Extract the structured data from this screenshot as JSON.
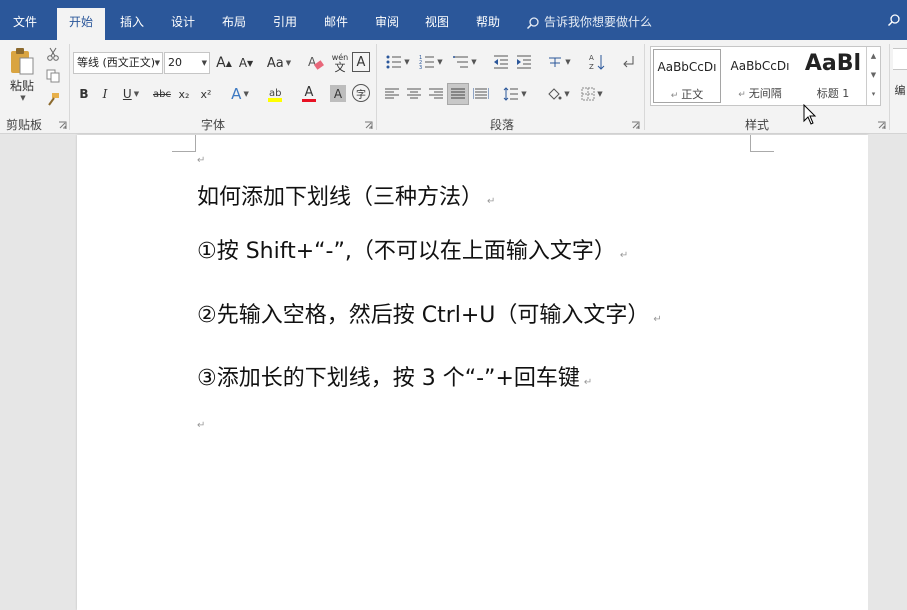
{
  "tabs": {
    "file": "文件",
    "home": "开始",
    "insert": "插入",
    "design": "设计",
    "layout": "布局",
    "references": "引用",
    "mailings": "邮件",
    "review": "审阅",
    "view": "视图",
    "help": "帮助"
  },
  "tell_me": "告诉我你想要做什么",
  "clipboard": {
    "paste_label": "粘贴",
    "group_label": "剪贴板"
  },
  "font": {
    "font_name": "等线 (西文正文)",
    "font_size": "20",
    "grow_label": "A",
    "shrink_label": "A",
    "case_label": "Aa",
    "phonetic_top": "wén",
    "phonetic_bottom": "文",
    "bold": "B",
    "italic": "I",
    "underline": "U",
    "strike": "abc",
    "subscript": "x₂",
    "superscript": "x²",
    "effects": "A",
    "font_color": "A",
    "shade": "A",
    "enclose": "字",
    "group_label": "字体"
  },
  "paragraph": {
    "group_label": "段落"
  },
  "styles": {
    "items": [
      {
        "preview": "AaBbCcDı",
        "name": "正文"
      },
      {
        "preview": "AaBbCcDı",
        "name": "无间隔"
      },
      {
        "preview": "AaBl",
        "name": "标题 1"
      }
    ],
    "group_label": "样式"
  },
  "editing": {
    "label": "编"
  },
  "document": {
    "lines": [
      "如何添加下划线（三种方法）",
      "①按 Shift+“-”,（不可以在上面输入文字）",
      "②先输入空格，然后按 Ctrl+U（可输入文字）",
      "③添加长的下划线，按 3 个“-”+回车键"
    ],
    "paragraph_mark": "↵"
  },
  "colors": {
    "title_bar": "#2b579a",
    "ribbon": "#f3f3f3",
    "highlight_yellow": "#ffff00",
    "font_red": "#e81123"
  }
}
